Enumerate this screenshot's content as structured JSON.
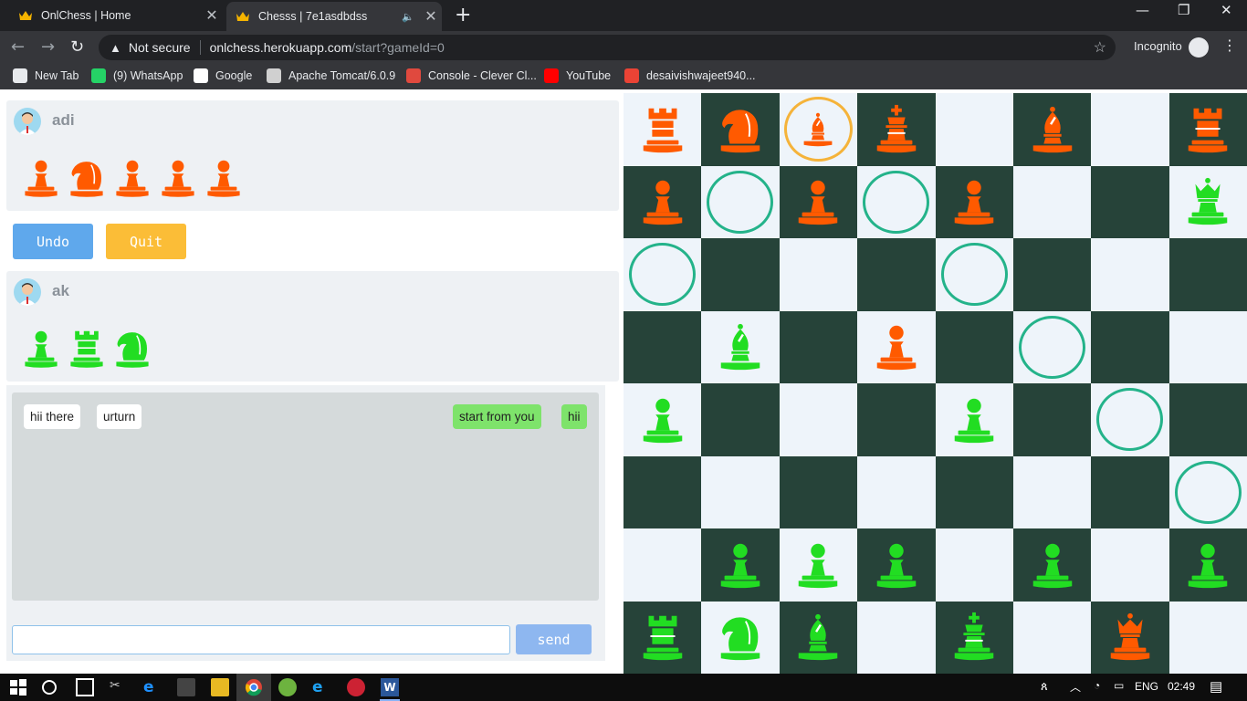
{
  "browser": {
    "tabs": [
      {
        "title": "OnlChess | Home",
        "active": false
      },
      {
        "title": "Chesss | 7e1asdbdss",
        "active": true
      }
    ],
    "url_warning": "Not secure",
    "url_host": "onlchess.herokuapp.com",
    "url_path": "/start?gameId=0",
    "incognito_label": "Incognito",
    "bookmarks": [
      {
        "label": "New Tab",
        "icon": "newtab-icon",
        "color": "#e8eaed"
      },
      {
        "label": "(9) WhatsApp",
        "icon": "whatsapp-icon",
        "color": "#25d366"
      },
      {
        "label": "Google",
        "icon": "google-icon",
        "color": "#ffffff"
      },
      {
        "label": "Apache Tomcat/6.0.9",
        "icon": "tomcat-icon",
        "color": "#d0d0d0"
      },
      {
        "label": "Console - Clever Cl...",
        "icon": "console-icon",
        "color": "#e0493e"
      },
      {
        "label": "YouTube",
        "icon": "youtube-icon",
        "color": "#ff0000"
      },
      {
        "label": "desaivishwajeet940...",
        "icon": "gmail-icon",
        "color": "#ea4335"
      }
    ]
  },
  "players": {
    "top": {
      "name": "adi",
      "captured": [
        "pawn",
        "knight",
        "pawn",
        "pawn",
        "pawn"
      ],
      "captured_color": "#ff5a00"
    },
    "bottom": {
      "name": "ak",
      "captured": [
        "pawn",
        "rook",
        "knight"
      ],
      "captured_color": "#22dd22"
    }
  },
  "controls": {
    "undo_label": "Undo",
    "quit_label": "Quit"
  },
  "chat": {
    "messages_them": [
      "hii there",
      "urturn"
    ],
    "messages_me": [
      "start from you",
      "hii"
    ],
    "input_value": "",
    "send_label": "send"
  },
  "board": {
    "colors": {
      "light": "#eef4fa",
      "dark": "#264339",
      "orange": "#ff5a00",
      "green": "#22dd22",
      "hint": "#24b38a",
      "selected": "#f5b33a"
    },
    "rows": [
      [
        "oR",
        "oN",
        "oB*",
        "oK",
        "",
        "oB",
        "",
        "oR"
      ],
      [
        "oP",
        "h",
        "oP",
        "h",
        "oP",
        "",
        "",
        "gQ"
      ],
      [
        "h",
        "",
        "",
        "",
        "h",
        "",
        "",
        ""
      ],
      [
        "",
        "gB",
        "",
        "oP",
        "",
        "h",
        "",
        ""
      ],
      [
        "gP",
        "",
        "",
        "",
        "gP",
        "",
        "h",
        ""
      ],
      [
        "",
        "",
        "",
        "",
        "",
        "",
        "",
        "h"
      ],
      [
        "",
        "gP",
        "gP",
        "gP",
        "",
        "gP",
        "",
        "gP"
      ],
      [
        "gR",
        "gN",
        "gB",
        "",
        "gK",
        "",
        "oQ",
        ""
      ]
    ]
  },
  "taskbar": {
    "lang": "ENG",
    "time": "02:49"
  }
}
